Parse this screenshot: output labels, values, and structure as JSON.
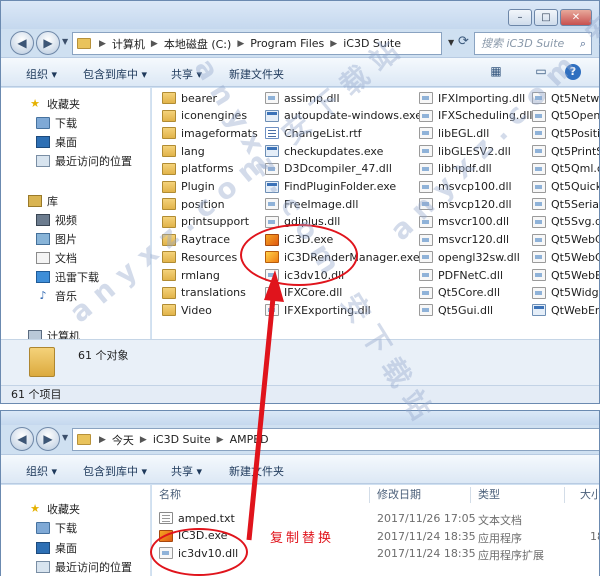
{
  "top_window": {
    "address": {
      "crumbs": [
        "计算机",
        "本地磁盘 (C:)",
        "Program Files",
        "iC3D Suite"
      ]
    },
    "search_placeholder": "搜索 iC3D Suite",
    "toolbar": {
      "organize": "组织 ▾",
      "include_library": "包含到库中 ▾",
      "share": "共享 ▾",
      "new_folder": "新建文件夹"
    },
    "nav": {
      "favorites": "收藏夹",
      "downloads": "下载",
      "desktop": "桌面",
      "recent": "最近访问的位置",
      "libraries": "库",
      "videos": "视频",
      "pictures": "图片",
      "documents": "文档",
      "thunder": "迅雷下载",
      "music": "音乐",
      "computer": "计算机"
    },
    "columns": [
      [
        "bearer",
        "iconengines",
        "imageformats",
        "lang",
        "platforms",
        "Plugin",
        "position",
        "printsupport",
        "Raytrace",
        "Resources",
        "rmlang",
        "translations",
        "Video"
      ],
      [
        "assimp.dll",
        "autoupdate-windows.exe",
        "ChangeList.rtf",
        "checkupdates.exe",
        "D3Dcompiler_47.dll",
        "FindPluginFolder.exe",
        "FreeImage.dll",
        "gdiplus.dll",
        "iC3D.exe",
        "iC3DRenderManager.exe",
        "ic3dv10.dll",
        "IFXCore.dll",
        "IFXExporting.dll"
      ],
      [
        "IFXImporting.dll",
        "IFXScheduling.dll",
        "libEGL.dll",
        "libGLESV2.dll",
        "libhpdf.dll",
        "msvcp100.dll",
        "msvcp120.dll",
        "msvcr100.dll",
        "msvcr120.dll",
        "opengl32sw.dll",
        "PDFNetC.dll",
        "Qt5Core.dll",
        "Qt5Gui.dll"
      ],
      [
        "Qt5Netw",
        "Qt5Open",
        "Qt5Positi",
        "Qt5PrintS",
        "Qt5Qml.c",
        "Qt5Quick",
        "Qt5Serial",
        "Qt5Svg.d",
        "Qt5WebC",
        "Qt5WebC",
        "Qt5WebE",
        "Qt5Widg",
        "QtWebEr"
      ]
    ],
    "column_types": [
      [
        "folder",
        "folder",
        "folder",
        "folder",
        "folder",
        "folder",
        "folder",
        "folder",
        "folder",
        "folder",
        "folder",
        "folder",
        "folder"
      ],
      [
        "dll",
        "exe",
        "rtf",
        "exe",
        "dll",
        "exe",
        "dll",
        "dll",
        "ic3d",
        "ic3dm",
        "dll",
        "dll",
        "dll"
      ],
      [
        "dll",
        "dll",
        "dll",
        "dll",
        "dll",
        "dll",
        "dll",
        "dll",
        "dll",
        "dll",
        "dll",
        "dll",
        "dll"
      ],
      [
        "dll",
        "dll",
        "dll",
        "dll",
        "dll",
        "dll",
        "dll",
        "dll",
        "dll",
        "dll",
        "dll",
        "dll",
        "exe"
      ]
    ],
    "details_count": "61 个对象",
    "status": "61 个项目"
  },
  "bottom_window": {
    "address": {
      "crumbs": [
        "今天",
        "iC3D Suite",
        "AMPED"
      ]
    },
    "toolbar": {
      "organize": "组织 ▾",
      "include_library": "包含到库中 ▾",
      "share": "共享 ▾",
      "new_folder": "新建文件夹"
    },
    "nav": {
      "favorites": "收藏夹",
      "downloads": "下载",
      "desktop": "桌面",
      "recent": "最近访问的位置"
    },
    "headers": {
      "name": "名称",
      "modified": "修改日期",
      "type": "类型",
      "size": "大小"
    },
    "files": [
      {
        "name": "amped.txt",
        "modified": "2017/11/26 17:05",
        "type": "文本文档",
        "size": "",
        "icon": "txt"
      },
      {
        "name": "IC3D.exe",
        "modified": "2017/11/24 18:35",
        "type": "应用程序",
        "size": "18",
        "icon": "ic3d"
      },
      {
        "name": "ic3dv10.dll",
        "modified": "2017/11/24 18:35",
        "type": "应用程序扩展",
        "size": "",
        "icon": "dll"
      }
    ]
  },
  "annotation_text": "复制替换",
  "watermark_text": "anyxz.com  安下载站",
  "colors": {
    "annotation_red": "#e0141c",
    "folder": "#e9c35c",
    "window_frame": "#cfe0f1"
  }
}
